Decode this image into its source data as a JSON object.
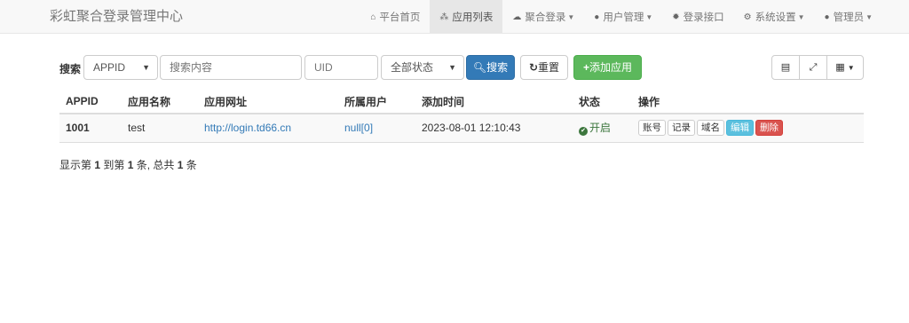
{
  "navbar": {
    "brand": "彩虹聚合登录管理中心",
    "items": [
      {
        "icon": "home-icon",
        "glyph": "⌂",
        "label": "平台首页",
        "caret": false
      },
      {
        "icon": "cubes-icon",
        "glyph": "⁂",
        "label": "应用列表",
        "caret": false,
        "active": true
      },
      {
        "icon": "cloud-icon",
        "glyph": "☁",
        "label": "聚合登录",
        "caret": true
      },
      {
        "icon": "user-icon",
        "glyph": "👤",
        "label": "用户管理",
        "caret": true
      },
      {
        "icon": "cog-icon",
        "glyph": "✹",
        "label": "登录接口",
        "caret": false
      },
      {
        "icon": "settings-icon",
        "glyph": "⚙",
        "label": "系统设置",
        "caret": true
      },
      {
        "icon": "admin-icon",
        "glyph": "👤",
        "label": "管理员",
        "caret": true
      }
    ]
  },
  "search": {
    "label": "搜索",
    "field_select": "APPID",
    "keyword_placeholder": "搜索内容",
    "uid_placeholder": "UID",
    "status_select": "全部状态",
    "search_button": "搜索",
    "reset_button": "重置",
    "add_button": "添加应用"
  },
  "table": {
    "headers": [
      "APPID",
      "应用名称",
      "应用网址",
      "所属用户",
      "添加时间",
      "状态",
      "操作"
    ],
    "rows": [
      {
        "appid": "1001",
        "name": "test",
        "url": "http://login.td66.cn",
        "user": "null[0]",
        "time": "2023-08-01 12:10:43",
        "status": "开启",
        "actions": [
          "账号",
          "记录",
          "域名",
          "编辑",
          "删除"
        ]
      }
    ]
  },
  "summary": {
    "prefix": "显示第 ",
    "from": "1",
    "mid1": " 到第 ",
    "to": "1",
    "mid2": " 条, 总共 ",
    "total": "1",
    "suffix": " 条"
  }
}
